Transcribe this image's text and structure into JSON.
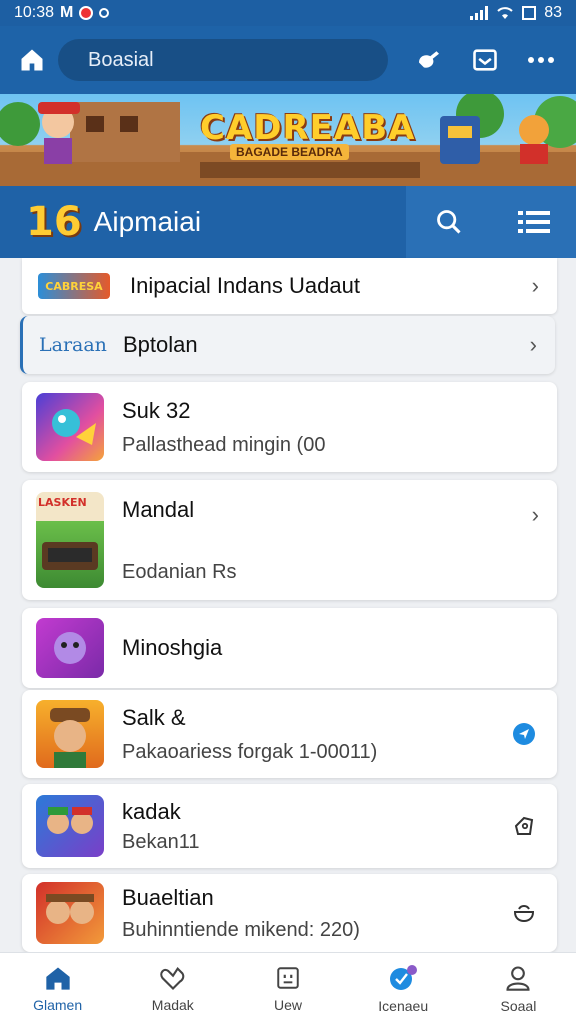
{
  "status_bar": {
    "time": "10:38",
    "carrier": "M",
    "battery": "83"
  },
  "app_bar": {
    "search_text": "Boasial",
    "actions": [
      "link-icon",
      "inbox-icon",
      "more-icon"
    ]
  },
  "banner": {
    "title": "CADREABA",
    "subtitle": "BAGADE BEADRA"
  },
  "section": {
    "number": "16",
    "title": "Aipmaiai"
  },
  "list": [
    {
      "thumb_text": "CABRESA",
      "title": "Inipacial Indans Uadaut",
      "subtitle": "",
      "trailing": "chevron"
    },
    {
      "thumb_text": "Laraan",
      "title": "Bptolan",
      "subtitle": "",
      "trailing": "chevron"
    },
    {
      "title": "Suk 32",
      "subtitle": "Pallasthead mingin (00",
      "trailing": ""
    },
    {
      "thumb_text": "LASKEN",
      "title": "Mandal",
      "subtitle": "Eodanian Rs",
      "trailing": "chevron"
    },
    {
      "title": "Minoshgia",
      "subtitle": "",
      "trailing": ""
    },
    {
      "title": "Salk &",
      "subtitle": "Pakaoariess forgak 1-00011)",
      "trailing": "send"
    },
    {
      "title": "kadak",
      "subtitle": "Bekan11",
      "trailing": "tag"
    },
    {
      "title": "Buaeltian",
      "subtitle": "Buhinntiende mikend: 220)",
      "trailing": "bowl"
    }
  ],
  "bottom_nav": [
    {
      "label": "Glamen",
      "icon": "home-icon",
      "active": true
    },
    {
      "label": "Madak",
      "icon": "heart-icon",
      "active": false
    },
    {
      "label": "Uew",
      "icon": "screen-icon",
      "active": false
    },
    {
      "label": "Icenaeu",
      "icon": "check-circle-icon",
      "active": false
    },
    {
      "label": "Soaal",
      "icon": "profile-icon",
      "active": false
    }
  ],
  "colors": {
    "primary": "#1e63a8",
    "primary_dark": "#184f86",
    "accent": "#ffcc33"
  }
}
